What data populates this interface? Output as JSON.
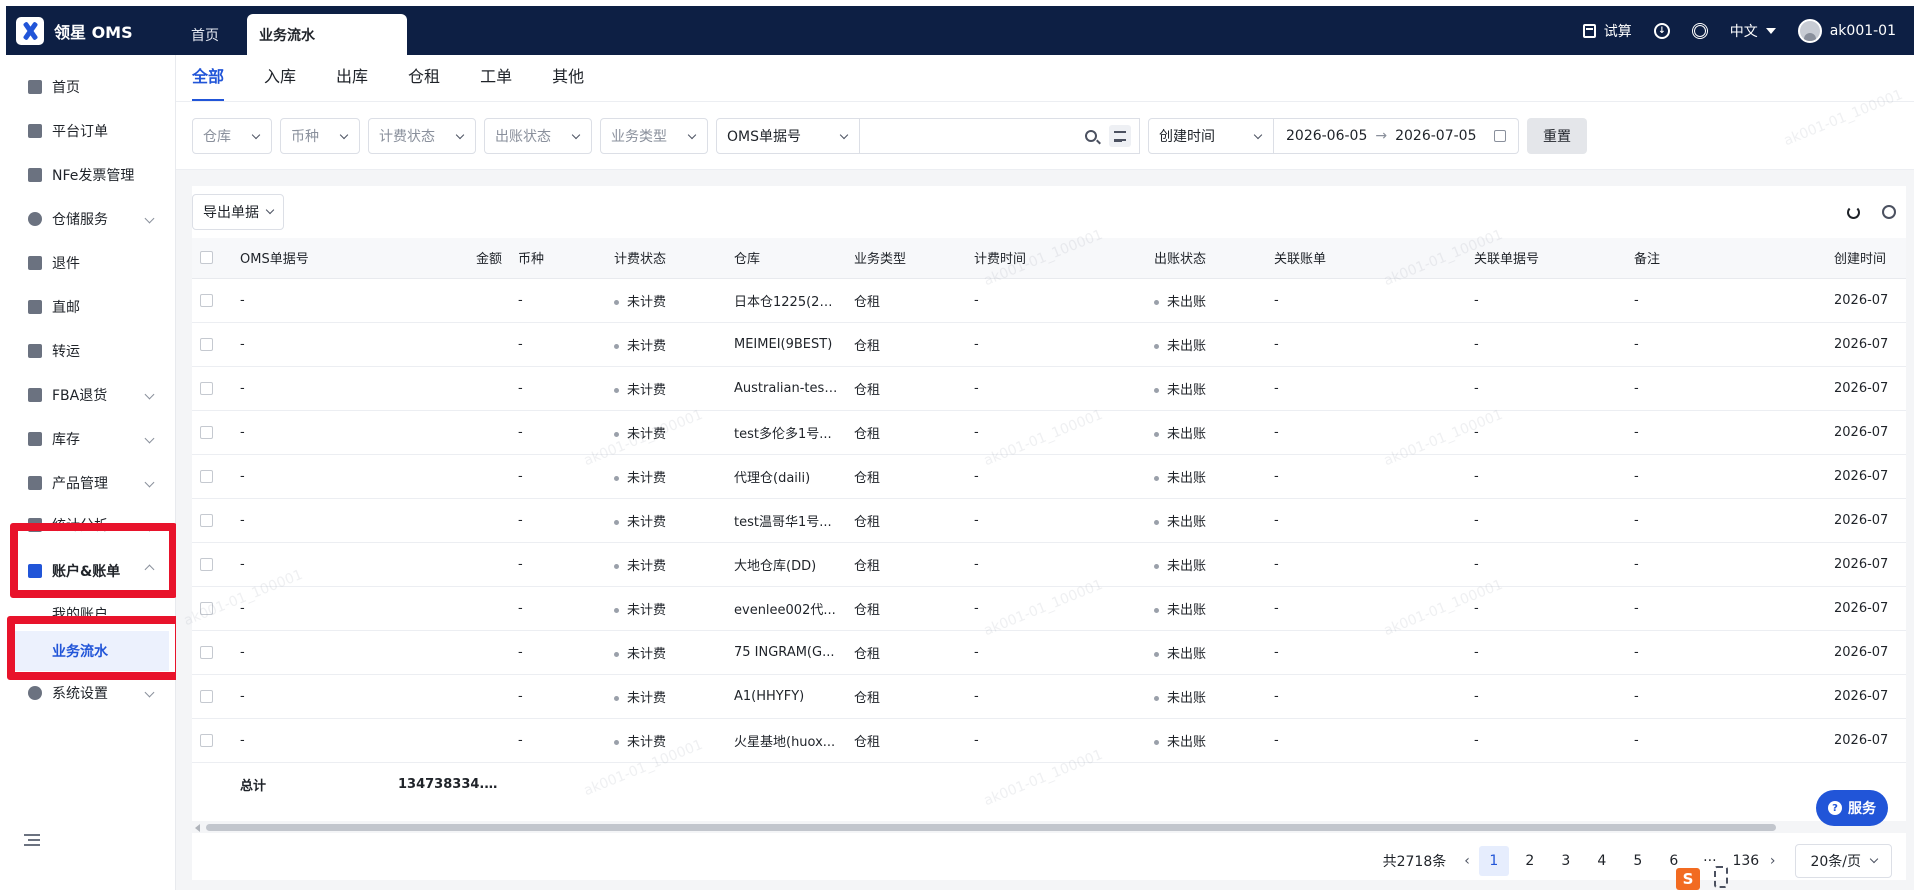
{
  "brand": {
    "name": "领星 OMS"
  },
  "top_tabs": [
    {
      "label": "首页",
      "active": false
    },
    {
      "label": "业务流水",
      "active": true
    }
  ],
  "top_right": {
    "trial": "试算",
    "language": "中文",
    "user": "ak001-01"
  },
  "sidebar": {
    "items": [
      {
        "label": "首页",
        "icon": "home-icon"
      },
      {
        "label": "平台订单",
        "icon": "order-icon"
      },
      {
        "label": "NFe发票管理",
        "icon": "invoice-icon"
      },
      {
        "label": "仓储服务",
        "icon": "warehouse-icon",
        "expandable": true
      },
      {
        "label": "退件",
        "icon": "return-icon"
      },
      {
        "label": "直邮",
        "icon": "mail-icon"
      },
      {
        "label": "转运",
        "icon": "transfer-icon"
      },
      {
        "label": "FBA退货",
        "icon": "fba-icon",
        "expandable": true
      },
      {
        "label": "库存",
        "icon": "inventory-icon",
        "expandable": true
      },
      {
        "label": "产品管理",
        "icon": "product-icon",
        "expandable": true
      },
      {
        "label": "统计分析",
        "icon": "stats-icon",
        "expandable": true
      }
    ],
    "account_group": {
      "label": "账户&账单",
      "children": [
        {
          "label": "我的账户",
          "active": false
        },
        {
          "label": "业务流水",
          "active": true
        }
      ]
    },
    "settings": {
      "label": "系统设置"
    }
  },
  "sub_tabs": [
    {
      "label": "全部",
      "active": true
    },
    {
      "label": "入库",
      "active": false
    },
    {
      "label": "出库",
      "active": false
    },
    {
      "label": "仓租",
      "active": false
    },
    {
      "label": "工单",
      "active": false
    },
    {
      "label": "其他",
      "active": false
    }
  ],
  "filters": {
    "warehouse": "仓库",
    "currency": "币种",
    "billing_status": "计费状态",
    "settle_status": "出账状态",
    "biz_type": "业务类型",
    "search_field": "OMS单据号",
    "search_value": "",
    "date_field": "创建时间",
    "date_start": "2026-06-05",
    "date_end": "2026-07-05",
    "reset": "重置"
  },
  "toolbar": {
    "export": "导出单据"
  },
  "table": {
    "headers": [
      "OMS单据号",
      "金额",
      "币种",
      "计费状态",
      "仓库",
      "业务类型",
      "计费时间",
      "出账状态",
      "关联账单",
      "关联单据号",
      "备注",
      "创建时间"
    ],
    "rows": [
      {
        "oms": "-",
        "amount": "",
        "currency": "-",
        "billing": "未计费",
        "warehouse": "日本仓1225(20...",
        "type": "仓租",
        "bill_time": "-",
        "settle": "未出账",
        "bill": "-",
        "ref": "-",
        "note": "-",
        "created": "2026-07"
      },
      {
        "oms": "-",
        "amount": "",
        "currency": "-",
        "billing": "未计费",
        "warehouse": "MEIMEI(9BEST)",
        "type": "仓租",
        "bill_time": "-",
        "settle": "未出账",
        "bill": "-",
        "ref": "-",
        "note": "-",
        "created": "2026-07"
      },
      {
        "oms": "-",
        "amount": "",
        "currency": "-",
        "billing": "未计费",
        "warehouse": "Australian-test...",
        "type": "仓租",
        "bill_time": "-",
        "settle": "未出账",
        "bill": "-",
        "ref": "-",
        "note": "-",
        "created": "2026-07"
      },
      {
        "oms": "-",
        "amount": "",
        "currency": "-",
        "billing": "未计费",
        "warehouse": "test多伦多1号...",
        "type": "仓租",
        "bill_time": "-",
        "settle": "未出账",
        "bill": "-",
        "ref": "-",
        "note": "-",
        "created": "2026-07"
      },
      {
        "oms": "-",
        "amount": "",
        "currency": "-",
        "billing": "未计费",
        "warehouse": "代理仓(daili)",
        "type": "仓租",
        "bill_time": "-",
        "settle": "未出账",
        "bill": "-",
        "ref": "-",
        "note": "-",
        "created": "2026-07"
      },
      {
        "oms": "-",
        "amount": "",
        "currency": "-",
        "billing": "未计费",
        "warehouse": "test温哥华1号...",
        "type": "仓租",
        "bill_time": "-",
        "settle": "未出账",
        "bill": "-",
        "ref": "-",
        "note": "-",
        "created": "2026-07"
      },
      {
        "oms": "-",
        "amount": "",
        "currency": "-",
        "billing": "未计费",
        "warehouse": "大地仓库(DD)",
        "type": "仓租",
        "bill_time": "-",
        "settle": "未出账",
        "bill": "-",
        "ref": "-",
        "note": "-",
        "created": "2026-07"
      },
      {
        "oms": "-",
        "amount": "",
        "currency": "-",
        "billing": "未计费",
        "warehouse": "evenlee002代...",
        "type": "仓租",
        "bill_time": "-",
        "settle": "未出账",
        "bill": "-",
        "ref": "-",
        "note": "-",
        "created": "2026-07"
      },
      {
        "oms": "-",
        "amount": "",
        "currency": "-",
        "billing": "未计费",
        "warehouse": "75 INGRAM(G...",
        "type": "仓租",
        "bill_time": "-",
        "settle": "未出账",
        "bill": "-",
        "ref": "-",
        "note": "-",
        "created": "2026-07"
      },
      {
        "oms": "-",
        "amount": "",
        "currency": "-",
        "billing": "未计费",
        "warehouse": "A1(HHYFY)",
        "type": "仓租",
        "bill_time": "-",
        "settle": "未出账",
        "bill": "-",
        "ref": "-",
        "note": "-",
        "created": "2026-07"
      },
      {
        "oms": "-",
        "amount": "",
        "currency": "-",
        "billing": "未计费",
        "warehouse": "火星基地(huox...",
        "type": "仓租",
        "bill_time": "-",
        "settle": "未出账",
        "bill": "-",
        "ref": "-",
        "note": "-",
        "created": "2026-07"
      }
    ],
    "total_label": "总计",
    "total_amount": "134738334.08..."
  },
  "pagination": {
    "total": "共2718条",
    "pages": [
      "1",
      "2",
      "3",
      "4",
      "5",
      "6"
    ],
    "ellipsis": "···",
    "last": "136",
    "page_size": "20条/页"
  },
  "service": {
    "label": "服务"
  },
  "watermark": "ak001-01_100001",
  "colors": {
    "topbar": "#0d1f44",
    "accent": "#2155d8",
    "highlight": "#e8132b"
  }
}
